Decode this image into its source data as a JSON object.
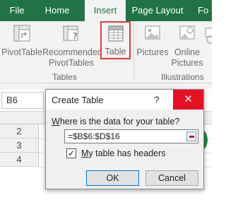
{
  "tabs": [
    {
      "label": "File",
      "active": false
    },
    {
      "label": "Home",
      "active": false
    },
    {
      "label": "Insert",
      "active": true
    },
    {
      "label": "Page Layout",
      "active": false
    },
    {
      "label": "Fo",
      "active": false
    }
  ],
  "ribbon": {
    "tables_group": {
      "label": "Tables",
      "pivottable": "PivotTable",
      "recommended_line1": "Recommended",
      "recommended_line2": "PivotTables",
      "table": "Table"
    },
    "illustrations_group": {
      "label": "Illustrations",
      "pictures": "Pictures",
      "online_line1": "Online",
      "online_line2": "Pictures"
    }
  },
  "formula_bar": {
    "name_box": "B6"
  },
  "sheet": {
    "row_numbers": [
      "2",
      "3",
      "4"
    ]
  },
  "dialog": {
    "title": "Create Table",
    "help": "?",
    "close": "✕",
    "prompt_underlined": "W",
    "prompt_rest": "here is the data for your table?",
    "range": "=$B$6:$D$16",
    "checkbox_mark": "✓",
    "checkbox_underlined": "M",
    "checkbox_rest": "y table has headers",
    "ok": "OK",
    "cancel": "Cancel"
  },
  "colors": {
    "tab_bar": "#217346",
    "highlight_border": "#e03a3a",
    "close_button": "#e81123"
  }
}
